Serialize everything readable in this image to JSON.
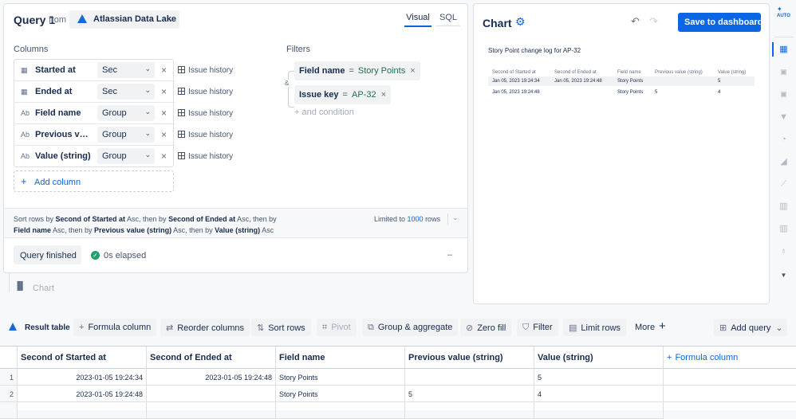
{
  "query": {
    "title": "Query 1",
    "from_label": "from",
    "source": "Atlassian Data Lake",
    "tabs": [
      "Visual",
      "SQL"
    ],
    "columns_label": "Columns",
    "filters_label": "Filters",
    "columns": [
      {
        "type_icon": "calendar-icon",
        "type_glyph": "▦",
        "name": "Started at",
        "agg": "Sec",
        "source": "Issue history"
      },
      {
        "type_icon": "calendar-icon",
        "type_glyph": "▦",
        "name": "Ended at",
        "agg": "Sec",
        "source": "Issue history"
      },
      {
        "type_icon": "text-type-icon",
        "type_glyph": "Ab",
        "name": "Field name",
        "agg": "Group",
        "source": "Issue history"
      },
      {
        "type_icon": "text-type-icon",
        "type_glyph": "Ab",
        "name": "Previous valu...",
        "agg": "Group",
        "source": "Issue history"
      },
      {
        "type_icon": "text-type-icon",
        "type_glyph": "Ab",
        "name": "Value (string)",
        "agg": "Group",
        "source": "Issue history"
      }
    ],
    "add_column": "Add column",
    "filters": [
      {
        "field": "Field name",
        "op": "=",
        "value": "Story Points"
      },
      {
        "field": "Issue key",
        "op": "=",
        "value": "AP-32"
      }
    ],
    "and_marker": "&",
    "add_condition": "+ and condition",
    "sort_text": {
      "prefix": "Sort rows by ",
      "p1": "Second of Started at",
      "a1": " Asc, then by ",
      "p2": "Second of Ended at",
      "a2": " Asc, then by ",
      "p3": "Field name",
      "a3": " Asc, then by ",
      "p4": "Previous value (string)",
      "a4": " Asc, then by ",
      "p5": "Value (string)",
      "a5": " Asc"
    },
    "limit_prefix": "Limited to ",
    "limit_value": "1000",
    "limit_suffix": " rows",
    "status_button": "Query finished",
    "elapsed": "0s elapsed",
    "collapse": "–",
    "chart_step": "Chart"
  },
  "chart": {
    "title": "Chart",
    "save_button": "Save to dashboard",
    "table_title": "Story Point change log for AP-32",
    "headers": [
      "Second of Started at",
      "Second of Ended at",
      "Field name",
      "Previous value (string)",
      "Value (string)"
    ],
    "rows": [
      [
        "Jan 05, 2023 19:24:34",
        "Jan 05, 2023 19:24:48",
        "Story Points",
        "",
        "5"
      ],
      [
        "Jan 05, 2023 19:24:48",
        "",
        "Story Points",
        "5",
        "4"
      ]
    ],
    "auto_label": "AUTO"
  },
  "toolbar": {
    "result_table": "Result table",
    "formula_column": "Formula column",
    "reorder_columns": "Reorder columns",
    "sort_rows": "Sort rows",
    "pivot": "Pivot",
    "group_aggregate": "Group & aggregate",
    "zero_fill": "Zero fill",
    "filter": "Filter",
    "limit_rows": "Limit rows",
    "more": "More",
    "add_query": "Add query"
  },
  "result": {
    "headers": [
      "Second of Started at",
      "Second of Ended at",
      "Field name",
      "Previous value (string)",
      "Value (string)"
    ],
    "formula_column": "Formula column",
    "rows": [
      {
        "n": "1",
        "c": [
          "2023-01-05 19:24:34",
          "2023-01-05 19:24:48",
          "Story Points",
          "",
          "5"
        ]
      },
      {
        "n": "2",
        "c": [
          "2023-01-05 19:24:48",
          "",
          "Story Points",
          "5",
          "4"
        ]
      }
    ]
  },
  "colors": {
    "accent": "#0c66e4",
    "save_bg": "#0c66e4",
    "success": "#22a06b"
  }
}
